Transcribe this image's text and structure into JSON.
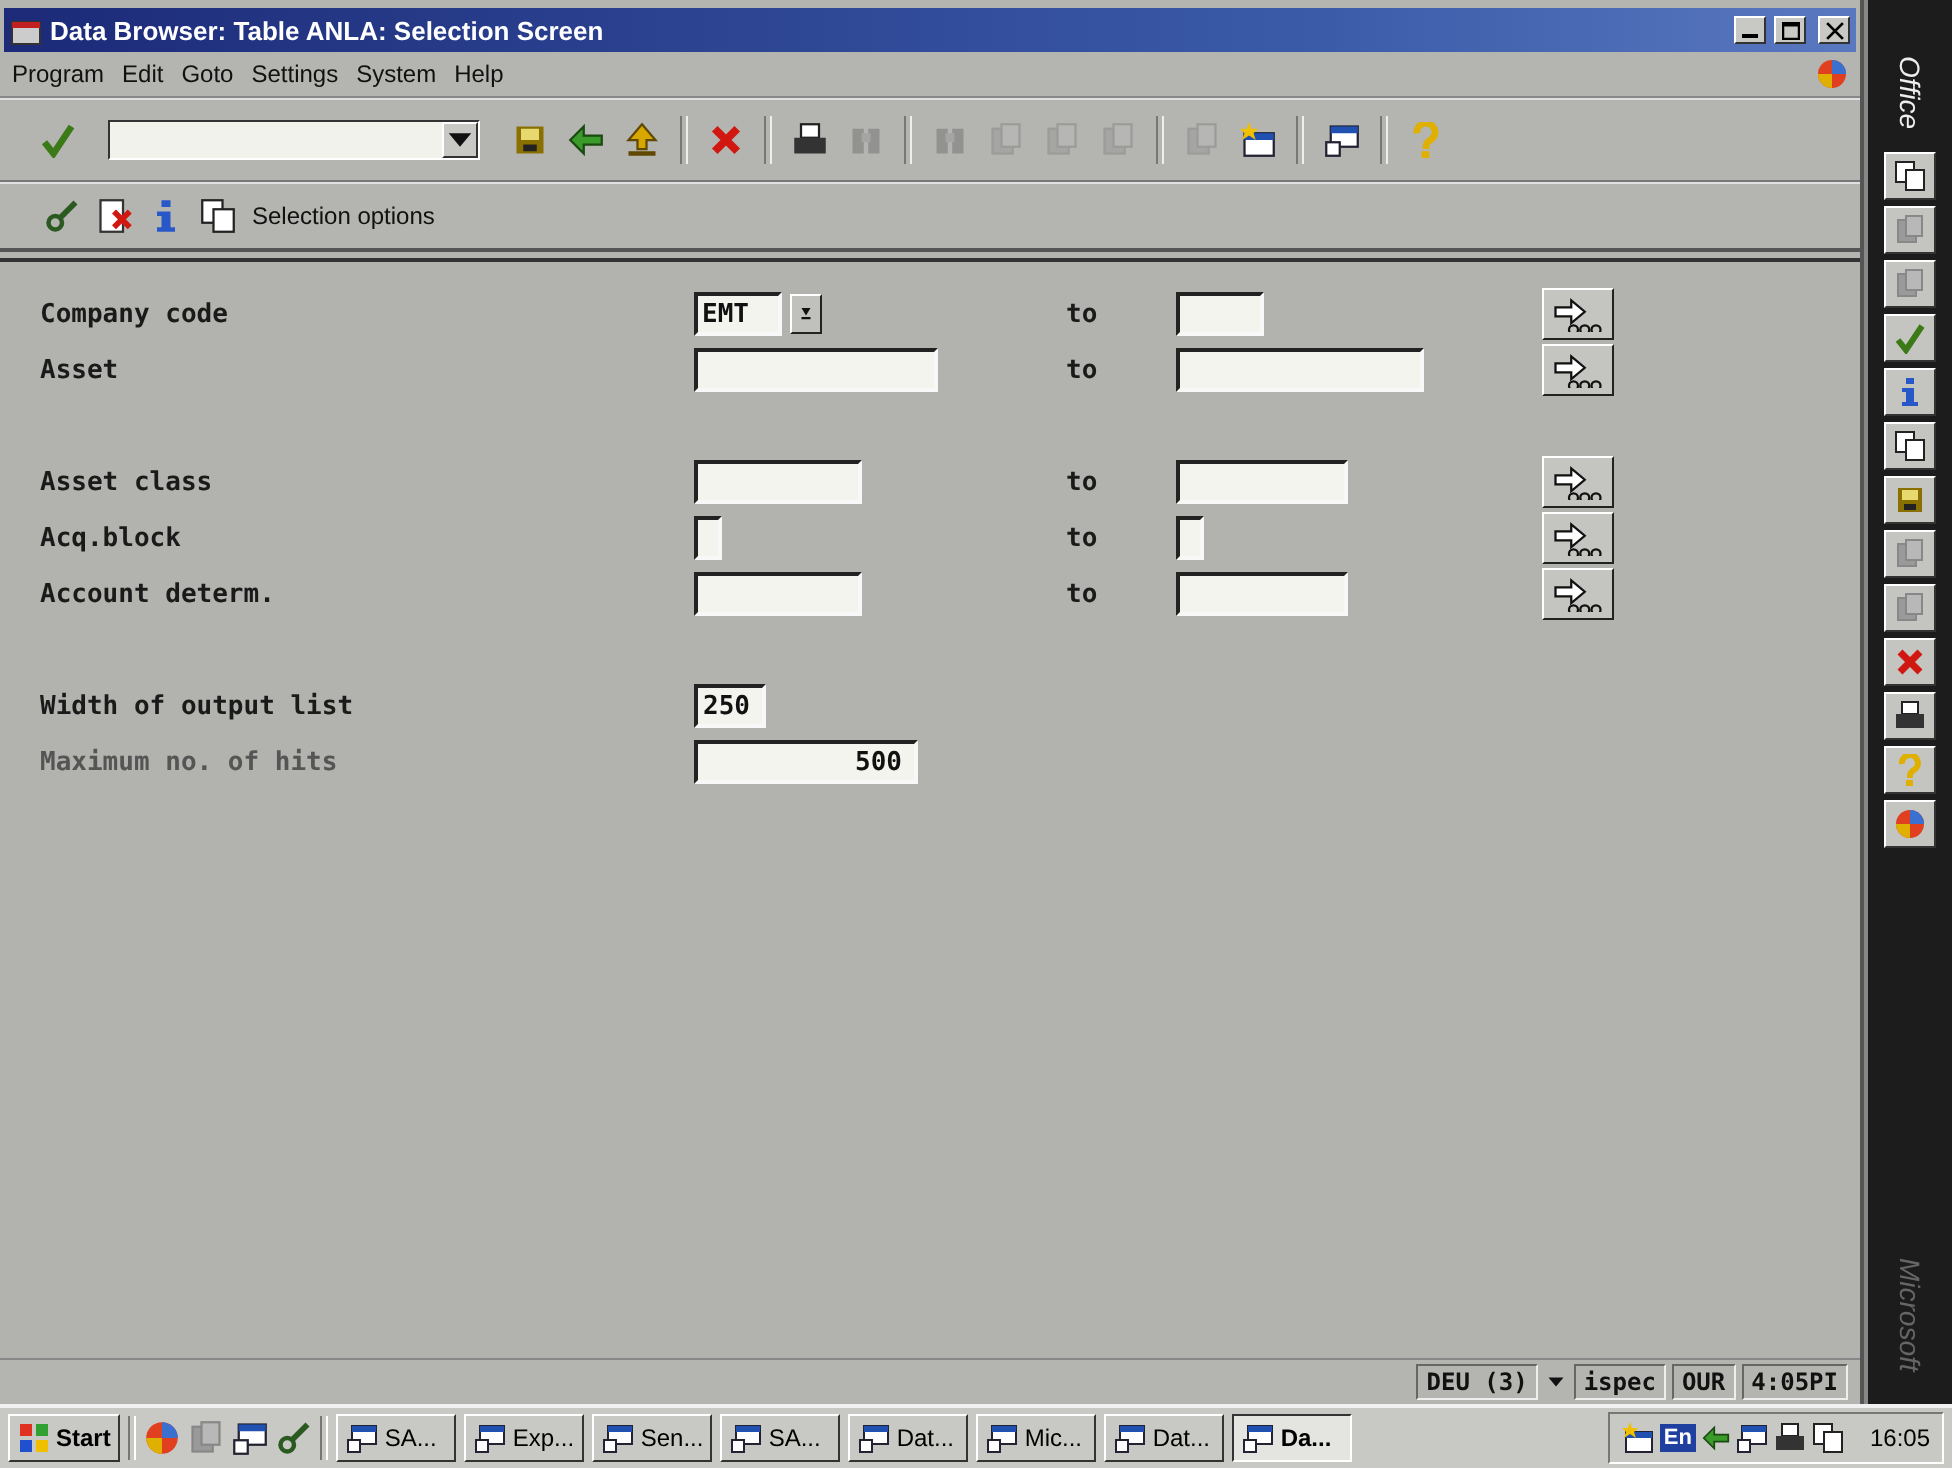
{
  "window": {
    "title": "Data Browser: Table ANLA: Selection Screen"
  },
  "menu": [
    "Program",
    "Edit",
    "Goto",
    "Settings",
    "System",
    "Help"
  ],
  "toolbar": [
    {
      "kind": "check",
      "disabled": false
    },
    {
      "kind": "command"
    },
    {
      "kind": "save",
      "disabled": false
    },
    {
      "kind": "back",
      "disabled": false
    },
    {
      "kind": "exit",
      "disabled": false
    },
    {
      "kind": "cancel",
      "disabled": false
    },
    {
      "kind": "print",
      "disabled": false
    },
    {
      "kind": "find",
      "disabled": true
    },
    {
      "kind": "find",
      "disabled": true
    },
    {
      "kind": "page",
      "disabled": true
    },
    {
      "kind": "page",
      "disabled": true
    },
    {
      "kind": "page",
      "disabled": true
    },
    {
      "kind": "page",
      "disabled": true
    },
    {
      "kind": "session",
      "disabled": false
    },
    {
      "kind": "shortcut",
      "disabled": false
    },
    {
      "kind": "help",
      "disabled": false
    }
  ],
  "app_toolbar": {
    "icons": [
      {
        "kind": "execute"
      },
      {
        "kind": "delete"
      },
      {
        "kind": "info"
      }
    ],
    "selection_button": "Selection options"
  },
  "selection": {
    "groups": [
      {
        "rows": [
          {
            "label": "Company code",
            "low": {
              "value": "EMT",
              "dropdown": true
            },
            "to": "to",
            "multiple": true
          },
          {
            "label": "Asset",
            "low": {
              "dropdown": false
            },
            "to": "to",
            "multiple": true
          }
        ]
      },
      {
        "rows": [
          {
            "label": "Asset class",
            "low": {
              "dropdown": false
            },
            "to": "to",
            "multiple": true
          },
          {
            "label": "Acq.block",
            "low": {
              "dropdown": false
            },
            "to": "to",
            "multiple": true
          },
          {
            "label": "Account determ.",
            "low": {
              "dropdown": false
            },
            "to": "to",
            "multiple": true
          }
        ]
      }
    ],
    "parameters": [
      {
        "label": "Width of output list",
        "value": "250",
        "dimmed": false
      },
      {
        "label": "Maximum no. of hits",
        "value": "500",
        "dimmed": true
      }
    ]
  },
  "status_bar": [
    "DEU (3)",
    "ispec",
    "OUR",
    "4:05PI"
  ],
  "taskbar": {
    "start": "Start",
    "tasks": [
      {
        "label": "SA...",
        "selected": false
      },
      {
        "label": "Exp...",
        "selected": false
      },
      {
        "label": "Sen...",
        "selected": false
      },
      {
        "label": "SA...",
        "selected": false
      },
      {
        "label": "Dat...",
        "selected": false
      },
      {
        "label": "Mic...",
        "selected": false
      },
      {
        "label": "Dat...",
        "selected": false
      },
      {
        "label": "Da...",
        "selected": true
      }
    ],
    "language": "En",
    "clock": "16:05"
  },
  "office_bar": {
    "title": "Office",
    "footer": "Microsoft",
    "buttons": [
      {
        "kind": "open"
      },
      {
        "kind": "new"
      },
      {
        "kind": "calendar"
      },
      {
        "kind": "task"
      },
      {
        "kind": "contact"
      },
      {
        "kind": "journal"
      },
      {
        "kind": "note"
      },
      {
        "kind": "office"
      },
      {
        "kind": "word"
      },
      {
        "kind": "excel"
      },
      {
        "kind": "powerpoint"
      },
      {
        "kind": "access"
      },
      {
        "kind": "outlook"
      }
    ]
  }
}
